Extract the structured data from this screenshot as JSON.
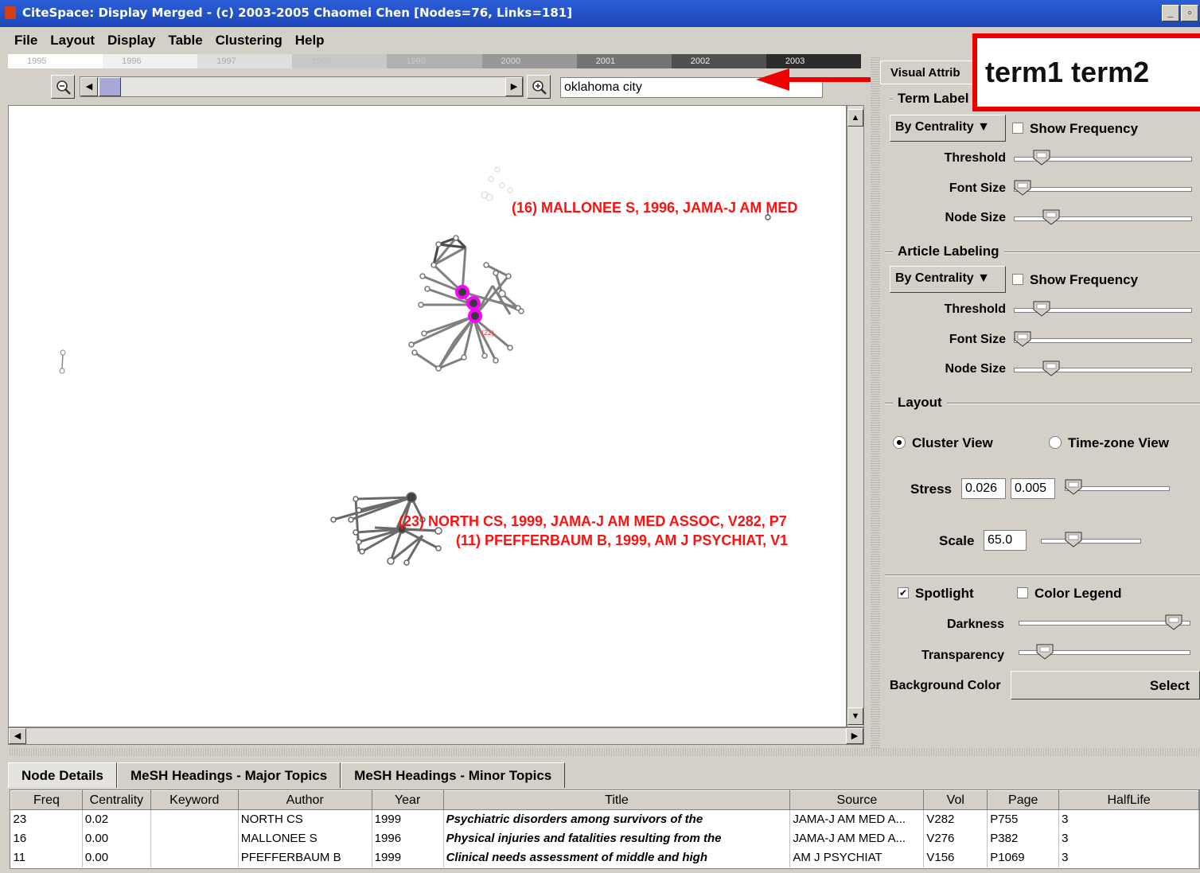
{
  "window": {
    "title": "CiteSpace: Display Merged - (c) 2003-2005 Chaomei Chen [Nodes=76, Links=181]",
    "minimize_glyph": "_",
    "restore_glyph": "▫"
  },
  "menu": [
    "File",
    "Layout",
    "Display",
    "Table",
    "Clustering",
    "Help"
  ],
  "timeline": [
    "1995",
    "1996",
    "1997",
    "1998",
    "1999",
    "2000",
    "2001",
    "2002",
    "2003"
  ],
  "search": {
    "value": "oklahoma city"
  },
  "callout": {
    "text": "term1 term2"
  },
  "graph": {
    "labels": [
      "(16) MALLONEE S, 1996, JAMA-J AM MED",
      "(23) NORTH CS, 1999, JAMA-J AM MED ASSOC, V282, P7",
      "(11) PFEFFERBAUM B, 1999, AM J PSYCHIAT, V1"
    ],
    "small_label": "(22)"
  },
  "right_panel": {
    "tab": "Visual Attrib",
    "term_labeling": {
      "title": "Term Label",
      "mode": "By Centrality",
      "show_frequency": "Show Frequency",
      "threshold": "Threshold",
      "font_size": "Font Size",
      "node_size": "Node Size"
    },
    "article_labeling": {
      "title": "Article Labeling",
      "mode": "By Centrality",
      "show_frequency": "Show Frequency",
      "threshold": "Threshold",
      "font_size": "Font Size",
      "node_size": "Node Size"
    },
    "layout": {
      "title": "Layout",
      "cluster_view": "Cluster View",
      "timezone_view": "Time-zone View",
      "stress_label": "Stress",
      "stress_a": "0.026",
      "stress_b": "0.005",
      "scale_label": "Scale",
      "scale_value": "65.0"
    },
    "spotlight": {
      "spotlight_label": "Spotlight",
      "color_legend_label": "Color Legend",
      "darkness": "Darkness",
      "transparency": "Transparency",
      "background_color": "Background Color",
      "select": "Select"
    }
  },
  "bottom_tabs": [
    "Node Details",
    "MeSH Headings - Major Topics",
    "MeSH Headings - Minor Topics"
  ],
  "table": {
    "columns": [
      "Freq",
      "Centrality",
      "Keyword",
      "Author",
      "Year",
      "Title",
      "Source",
      "Vol",
      "Page",
      "HalfLife"
    ],
    "rows": [
      [
        "23",
        "0.02",
        "",
        "NORTH CS",
        "1999",
        "Psychiatric disorders among survivors of the",
        "JAMA-J AM MED A...",
        "V282",
        "P755",
        "3"
      ],
      [
        "16",
        "0.00",
        "",
        "MALLONEE S",
        "1996",
        "Physical injuries and fatalities resulting from the",
        "JAMA-J AM MED A...",
        "V276",
        "P382",
        "3"
      ],
      [
        "11",
        "0.00",
        "",
        "PFEFFERBAUM B",
        "1999",
        "Clinical needs assessment of middle and high",
        "AM J PSYCHIAT",
        "V156",
        "P1069",
        "3"
      ]
    ]
  },
  "colors": {
    "highlight_node": "#ff00ff",
    "label_red": "#ff1010",
    "title_bar": "#1c46b8",
    "callout_red": "#ee0000"
  }
}
